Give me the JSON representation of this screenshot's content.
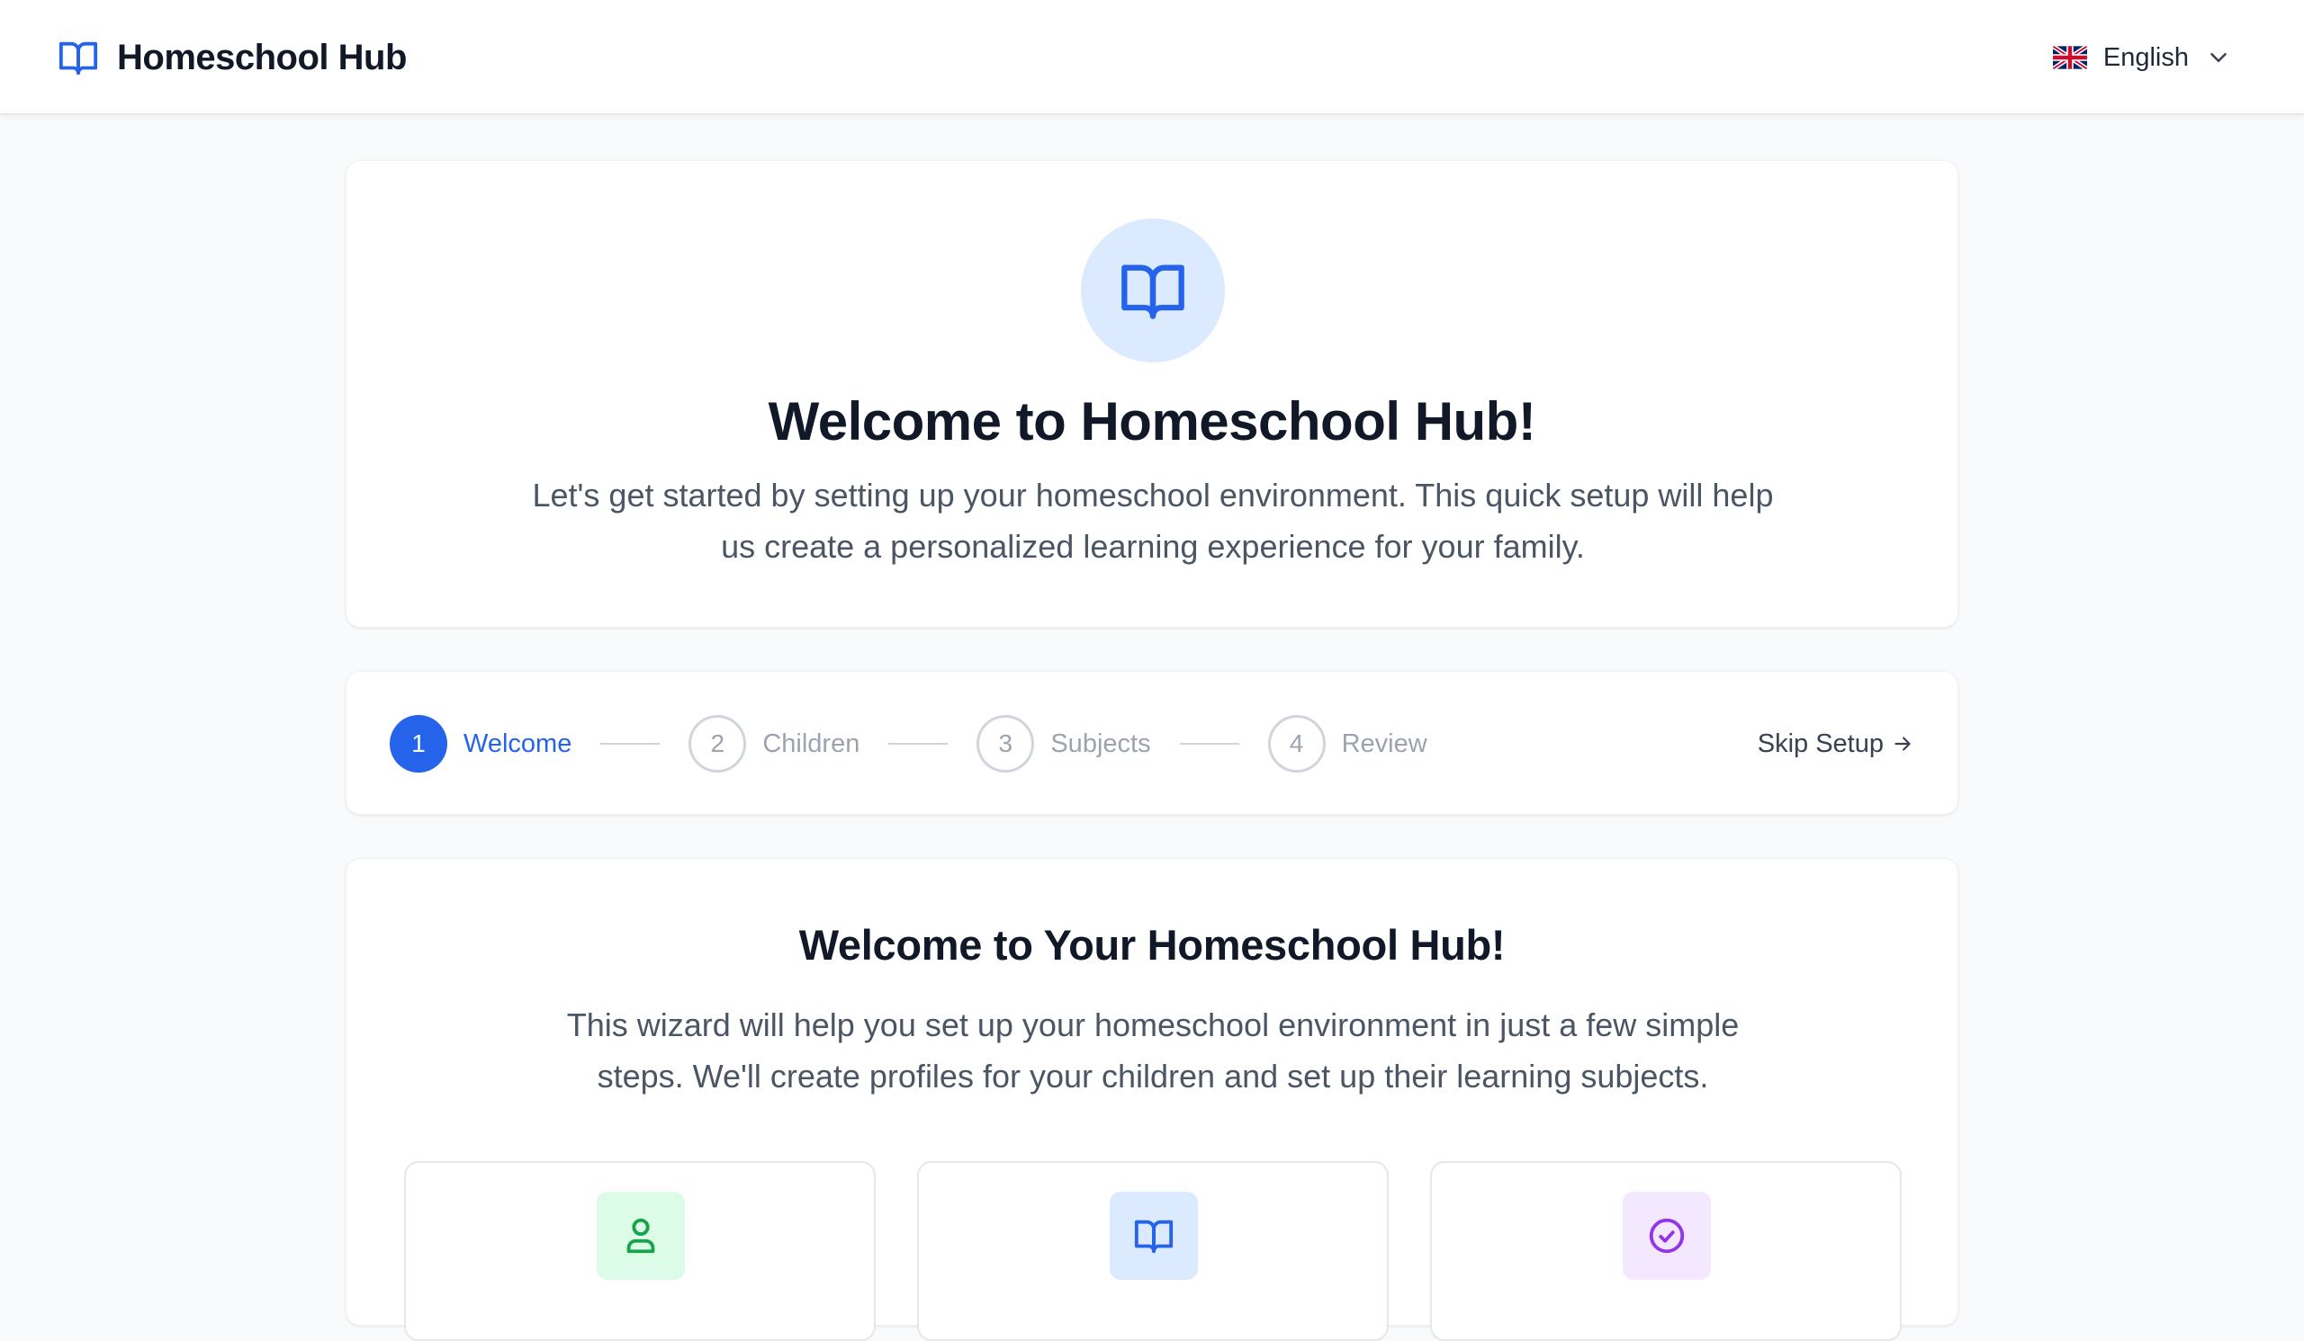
{
  "header": {
    "brand_icon": "book-open-icon",
    "title": "Homeschool Hub",
    "language": {
      "flag": "uk-flag-icon",
      "label": "English",
      "chevron": "chevron-down-icon"
    }
  },
  "hero": {
    "icon": "book-open-icon",
    "title": "Welcome to Homeschool Hub!",
    "subtitle": "Let's get started by setting up your homeschool environment. This quick setup will help us create a personalized learning experience for your family."
  },
  "stepper": {
    "steps": [
      {
        "number": "1",
        "label": "Welcome",
        "state": "active"
      },
      {
        "number": "2",
        "label": "Children",
        "state": "pending"
      },
      {
        "number": "3",
        "label": "Subjects",
        "state": "pending"
      },
      {
        "number": "4",
        "label": "Review",
        "state": "pending"
      }
    ],
    "skip_label": "Skip Setup",
    "skip_icon": "arrow-right-icon"
  },
  "content": {
    "title": "Welcome to Your Homeschool Hub!",
    "subtitle": "This wizard will help you set up your homeschool environment in just a few simple steps. We'll create profiles for your children and set up their learning subjects.",
    "features": [
      {
        "icon": "user-icon",
        "color": "#16a34a"
      },
      {
        "icon": "book-open-icon",
        "color": "#2563eb"
      },
      {
        "icon": "check-circle-icon",
        "color": "#9333ea"
      }
    ]
  },
  "colors": {
    "accent": "#2563eb",
    "background": "#f9fafb",
    "text": "#111827",
    "muted": "#9ca3af"
  }
}
